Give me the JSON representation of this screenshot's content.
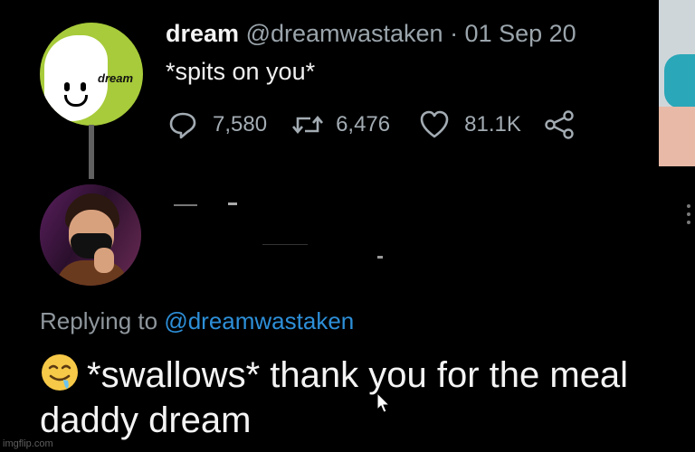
{
  "tweet": {
    "display_name": "dream",
    "handle_date": "@dreamwastaken · 01 Sep 20",
    "text": "*spits on you*",
    "avatar_tag": "dream",
    "stats": {
      "replies": "7,580",
      "retweets": "6,476",
      "likes": "81.1K"
    }
  },
  "reply": {
    "replying_prefix": "Replying to",
    "replying_handle": "@dreamwastaken",
    "text": "*swallows* thank you for the meal daddy dream"
  },
  "watermark": "imgflip.com",
  "icons": {
    "reply": "reply-icon",
    "retweet": "retweet-icon",
    "like": "heart-icon",
    "share": "share-icon",
    "emoji": "drooling-face-emoji",
    "cursor": "mouse-cursor-icon"
  },
  "colors": {
    "background": "#000000",
    "link": "#2d8fd8",
    "muted": "#9aa4ab",
    "dream_green": "#a7cb3a"
  }
}
